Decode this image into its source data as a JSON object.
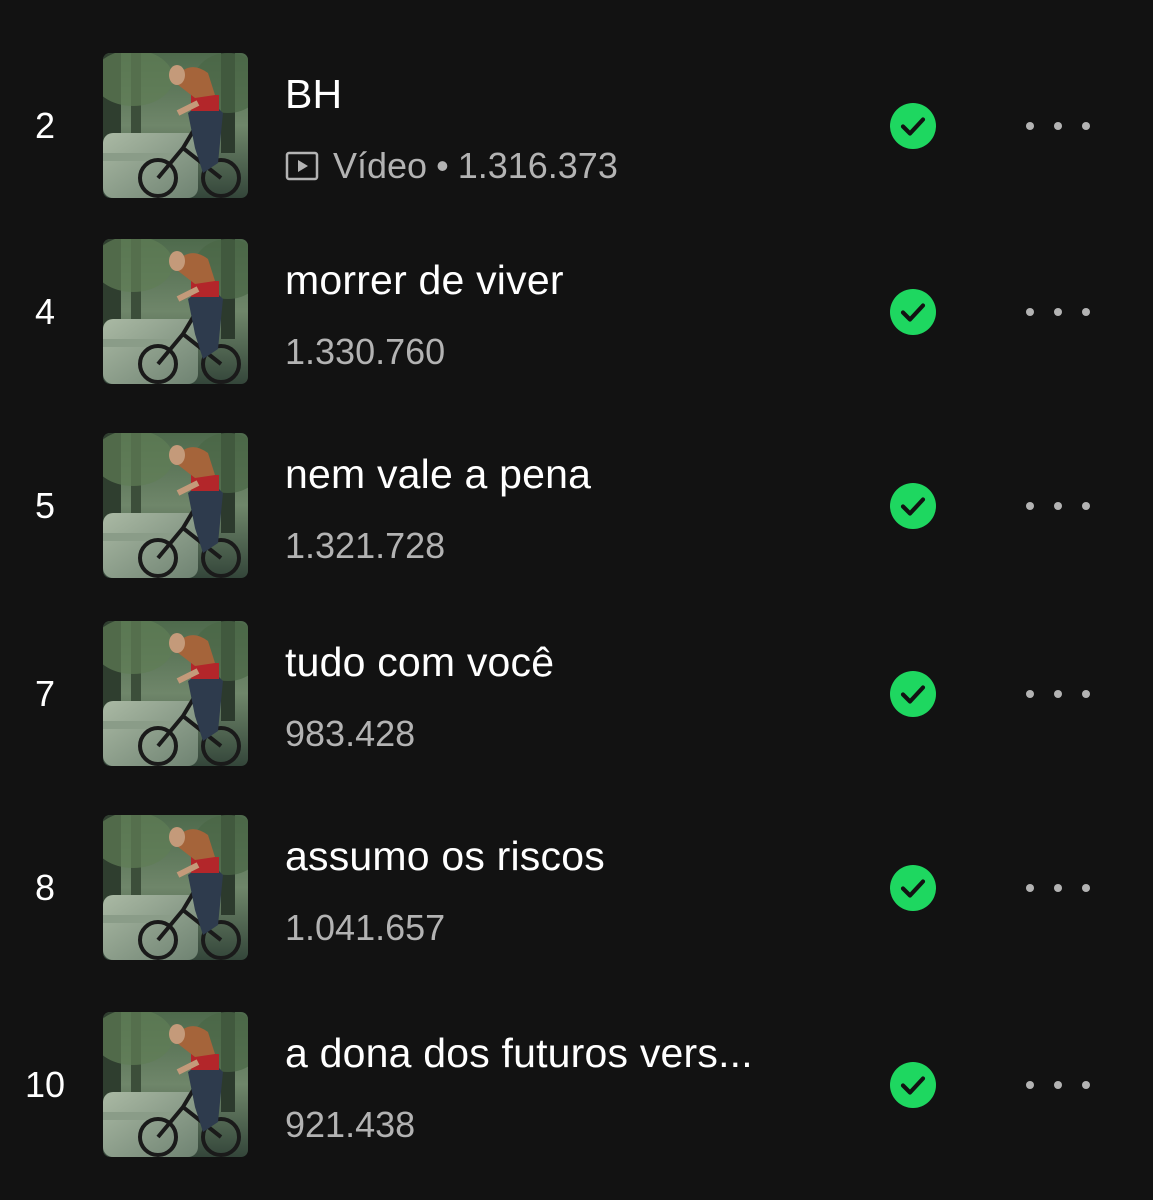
{
  "colors": {
    "background": "#121212",
    "title": "#ffffff",
    "subtitle": "#b3b3b3",
    "accent": "#1ed760"
  },
  "icons": {
    "video": "video-icon",
    "downloaded": "downloaded-check-icon",
    "more": "more-options-icon"
  },
  "tracks": [
    {
      "number": "2",
      "title": "BH",
      "is_video": true,
      "video_label": "Vídeo",
      "separator": "•",
      "plays": "1.316.373"
    },
    {
      "number": "4",
      "title": "morrer de viver",
      "is_video": false,
      "plays": "1.330.760"
    },
    {
      "number": "5",
      "title": "nem vale a pena",
      "is_video": false,
      "plays": "1.321.728"
    },
    {
      "number": "7",
      "title": "tudo com você",
      "is_video": false,
      "plays": "983.428"
    },
    {
      "number": "8",
      "title": "assumo os riscos",
      "is_video": false,
      "plays": "1.041.657"
    },
    {
      "number": "10",
      "title": "a dona dos futuros vers...",
      "is_video": false,
      "plays": "921.438"
    }
  ]
}
